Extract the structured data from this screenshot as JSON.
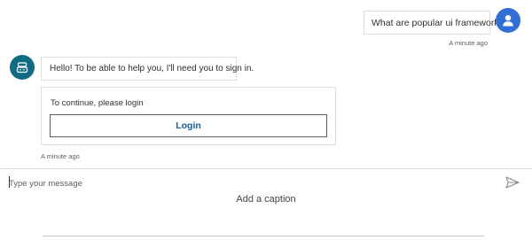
{
  "user_message": {
    "text": "What are popular ui frameworks",
    "timestamp": "A minute ago",
    "avatar_icon": "person-icon",
    "avatar_color": "#2f6fd6"
  },
  "bot_message": {
    "text": "Hello! To be able to help you, I'll need you to sign in.",
    "avatar_icon": "bot-icon",
    "avatar_color": "#126b84"
  },
  "signin_card": {
    "prompt": "To continue, please login",
    "button_label": "Login",
    "button_color": "#1a5ea8"
  },
  "bot_timestamp": "A minute ago",
  "composer": {
    "placeholder": "Type your message",
    "send_icon": "send-icon"
  },
  "caption": "Add a caption"
}
